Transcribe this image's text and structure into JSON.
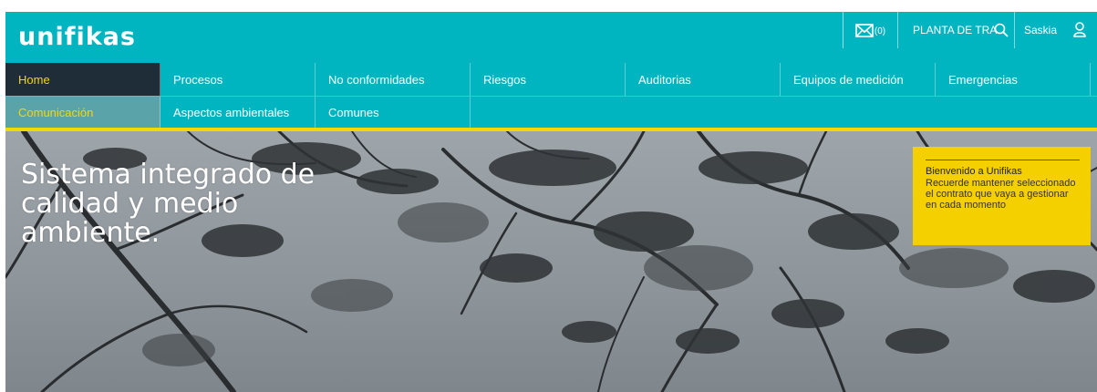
{
  "brand": {
    "logo_text": "unifikas",
    "accent": "#00b5c0",
    "highlight": "#f4d900"
  },
  "header": {
    "mail_icon": "envelope-icon",
    "mail_count": "(0)",
    "plant": "PLANTA DE TRATAMIENTO",
    "search_icon": "search-icon",
    "user": "Saskia",
    "user_icon": "user-icon"
  },
  "nav": {
    "row1": [
      "Home",
      "Procesos",
      "No conformidades",
      "Riesgos",
      "Auditorias",
      "Equipos de medición",
      "Emergencias"
    ],
    "row2": [
      "Comunicación",
      "Aspectos ambientales",
      "Comunes"
    ]
  },
  "hero": {
    "title_line1": "Sistema integrado de",
    "title_line2": "calidad y medio",
    "title_line3": "ambiente."
  },
  "welcome": {
    "title": "Bienvenido a Unifikas",
    "text": "Recuerde mantener seleccionado el contrato que vaya a gestionar en cada momento"
  }
}
